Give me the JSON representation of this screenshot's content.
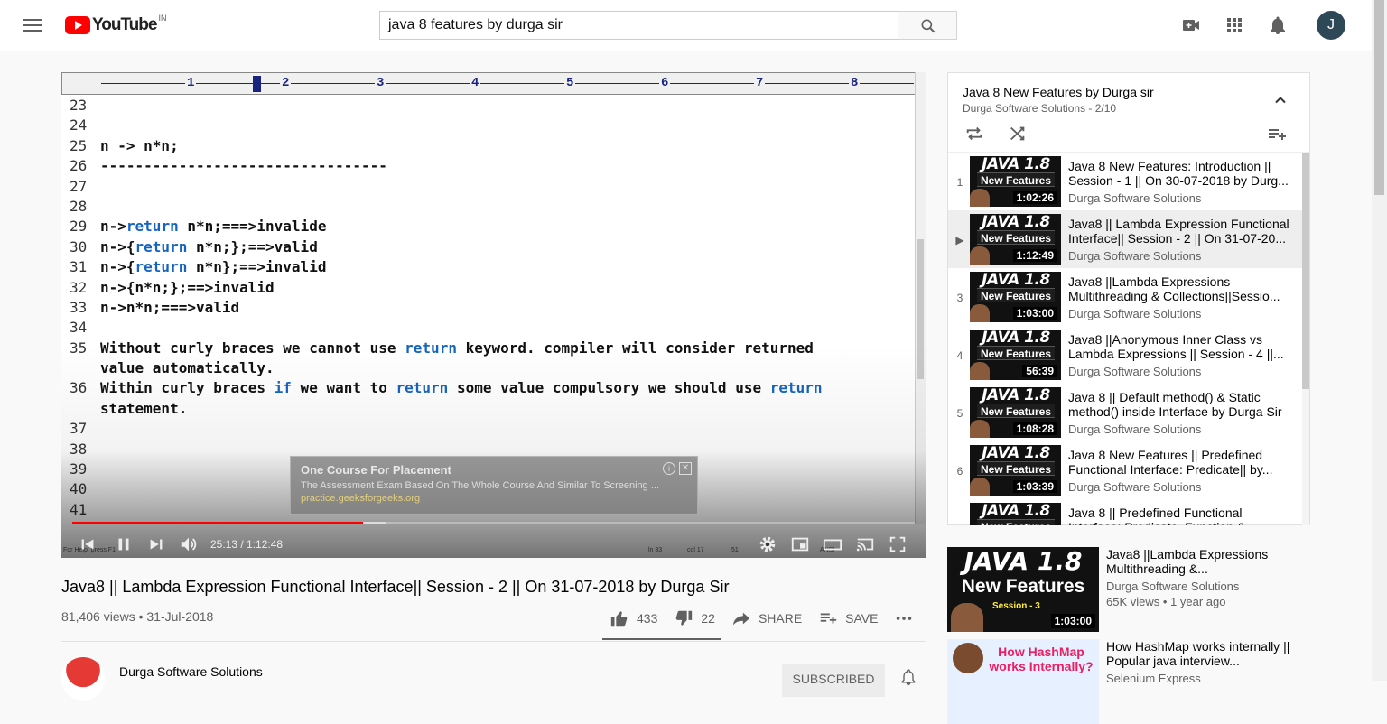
{
  "header": {
    "logo_text": "YouTube",
    "country_code": "IN",
    "search_value": "java 8 features by durga sir",
    "avatar_letter": "J"
  },
  "player": {
    "ruler_numbers": [
      "1",
      "2",
      "3",
      "4",
      "5",
      "6",
      "7",
      "8"
    ],
    "code_lines": [
      {
        "n": "23",
        "parts": [
          {
            "t": "",
            "k": false
          }
        ]
      },
      {
        "n": "24",
        "parts": [
          {
            "t": "",
            "k": false
          }
        ]
      },
      {
        "n": "25",
        "parts": [
          {
            "t": "n -> n*n;",
            "k": false
          }
        ]
      },
      {
        "n": "26",
        "parts": [
          {
            "t": "---------------------------------",
            "k": false
          }
        ]
      },
      {
        "n": "27",
        "parts": [
          {
            "t": "",
            "k": false
          }
        ]
      },
      {
        "n": "28",
        "parts": [
          {
            "t": "",
            "k": false
          }
        ]
      },
      {
        "n": "29",
        "parts": [
          {
            "t": "n->",
            "k": false
          },
          {
            "t": "return",
            "k": true
          },
          {
            "t": " n*n;===>invalide",
            "k": false
          }
        ]
      },
      {
        "n": "30",
        "parts": [
          {
            "t": "n->{",
            "k": false
          },
          {
            "t": "return",
            "k": true
          },
          {
            "t": " n*n;};==>valid",
            "k": false
          }
        ]
      },
      {
        "n": "31",
        "parts": [
          {
            "t": "n->{",
            "k": false
          },
          {
            "t": "return",
            "k": true
          },
          {
            "t": " n*n};==>invalid",
            "k": false
          }
        ]
      },
      {
        "n": "32",
        "parts": [
          {
            "t": "n->{n*n;};==>invalid",
            "k": false
          }
        ]
      },
      {
        "n": "33",
        "parts": [
          {
            "t": "n->n*n;===>valid",
            "k": false
          }
        ]
      },
      {
        "n": "34",
        "parts": [
          {
            "t": "",
            "k": false
          }
        ]
      },
      {
        "n": "35",
        "parts": [
          {
            "t": "Without curly braces we cannot use ",
            "k": false
          },
          {
            "t": "return",
            "k": true
          },
          {
            "t": " keyword. compiler will consider returned",
            "k": false
          }
        ]
      },
      {
        "n": "",
        "parts": [
          {
            "t": "value automatically.",
            "k": false
          }
        ]
      },
      {
        "n": "36",
        "parts": [
          {
            "t": "Within curly braces ",
            "k": false
          },
          {
            "t": "if",
            "k": true
          },
          {
            "t": " we want to ",
            "k": false
          },
          {
            "t": "return",
            "k": true
          },
          {
            "t": " some value compulsory we should use ",
            "k": false
          },
          {
            "t": "return",
            "k": true
          }
        ]
      },
      {
        "n": "",
        "parts": [
          {
            "t": "statement.",
            "k": false
          }
        ]
      },
      {
        "n": "37",
        "parts": [
          {
            "t": "",
            "k": false
          }
        ]
      },
      {
        "n": "38",
        "parts": [
          {
            "t": "",
            "k": false
          }
        ]
      },
      {
        "n": "39",
        "parts": [
          {
            "t": "",
            "k": false
          }
        ]
      },
      {
        "n": "40",
        "parts": [
          {
            "t": "",
            "k": false
          }
        ]
      },
      {
        "n": "41",
        "parts": [
          {
            "t": "",
            "k": false
          }
        ]
      }
    ],
    "ad": {
      "title": "One Course For Placement",
      "text": "The Assessment Exam Based On The Whole Course And Similar To Screening ...",
      "url": "practice.geeksforgeeks.org",
      "close": "✕",
      "info": "i"
    },
    "status_left": "For Help, press F1",
    "status_ln": "ln 33",
    "status_col": "col 17",
    "status_num": "51",
    "status_enc": "ANSI",
    "time": "25:13 / 1:12:48",
    "progress_played": 0.345,
    "progress_buffered": 0.372
  },
  "video": {
    "title": "Java8 || Lambda Expression Functional Interface|| Session - 2 || On 31-07-2018 by Durga Sir",
    "views": "81,406 views • 31-Jul-2018",
    "likes": "433",
    "dislikes": "22",
    "share": "SHARE",
    "save": "SAVE",
    "channel": "Durga Software Solutions",
    "subscribed": "SUBSCRIBED"
  },
  "playlist": {
    "title": "Java 8 New Features by Durga sir",
    "subtitle": "Durga Software Solutions - 2/10",
    "items": [
      {
        "idx": "1",
        "title": "Java 8 New Features: Introduction || Session - 1 || On 30-07-2018 by Durg...",
        "channel": "Durga Software Solutions",
        "duration": "1:02:26"
      },
      {
        "idx": "▶",
        "title": "Java8 || Lambda Expression Functional Interface|| Session - 2 || On 31-07-20...",
        "channel": "Durga Software Solutions",
        "duration": "1:12:49"
      },
      {
        "idx": "3",
        "title": "Java8 ||Lambda Expressions Multithreading & Collections||Sessio...",
        "channel": "Durga Software Solutions",
        "duration": "1:03:00"
      },
      {
        "idx": "4",
        "title": "Java8 ||Anonymous Inner Class vs Lambda Expressions || Session - 4 ||...",
        "channel": "Durga Software Solutions",
        "duration": "56:39"
      },
      {
        "idx": "5",
        "title": "Java 8 || Default method() & Static method() inside Interface by Durga Sir",
        "channel": "Durga Software Solutions",
        "duration": "1:08:28"
      },
      {
        "idx": "6",
        "title": "Java 8 New Features || Predefined Functional Interface: Predicate|| by...",
        "channel": "Durga Software Solutions",
        "duration": "1:03:39"
      },
      {
        "idx": "",
        "title": "Java 8 || Predefined Functional Interface: Predicate, Function &...",
        "channel": "Durga Software Solutions",
        "duration": ""
      }
    ],
    "thumb_java": "JAVA 1.8",
    "thumb_nf": "New Features"
  },
  "recommended": [
    {
      "title": "Java8 ||Lambda Expressions Multithreading &...",
      "channel": "Durga Software Solutions",
      "views": "65K views • 1 year ago",
      "duration": "1:03:00",
      "thumb_java": "JAVA 1.8",
      "thumb_nf": "New Features",
      "thumb_session": "Session - 3"
    },
    {
      "title": "How HashMap works internally || Popular java interview...",
      "channel": "Selenium Express",
      "views": "",
      "duration": "",
      "thumb_text": "How HashMap works Internally?"
    }
  ],
  "colors": {
    "brand_red": "#ff0000",
    "keyword_blue": "#1565c0",
    "ruler_navy": "#1a237e"
  }
}
